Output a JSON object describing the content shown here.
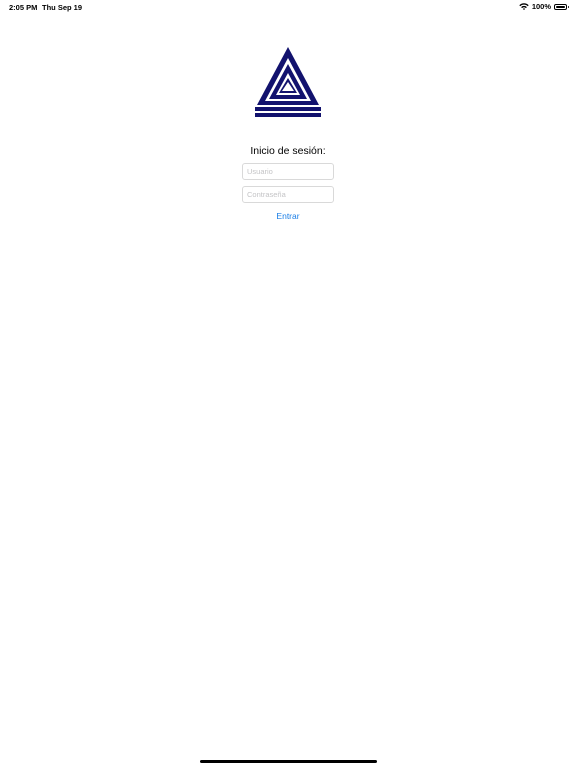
{
  "status_bar": {
    "time": "2:05 PM",
    "date": "Thu Sep 19",
    "battery_percent": "100%",
    "battery_level": 1.0,
    "icons": [
      "wifi-icon",
      "battery-icon"
    ]
  },
  "logo": {
    "icon": "triangle-logo",
    "color": "#12126e"
  },
  "login": {
    "title": "Inicio de sesión:",
    "username": {
      "placeholder": "Usuario",
      "value": ""
    },
    "password": {
      "placeholder": "Contraseña",
      "value": ""
    },
    "submit_label": "Entrar"
  },
  "colors": {
    "accent": "#1a7ee6",
    "logo": "#12126e",
    "background": "#ffffff"
  }
}
